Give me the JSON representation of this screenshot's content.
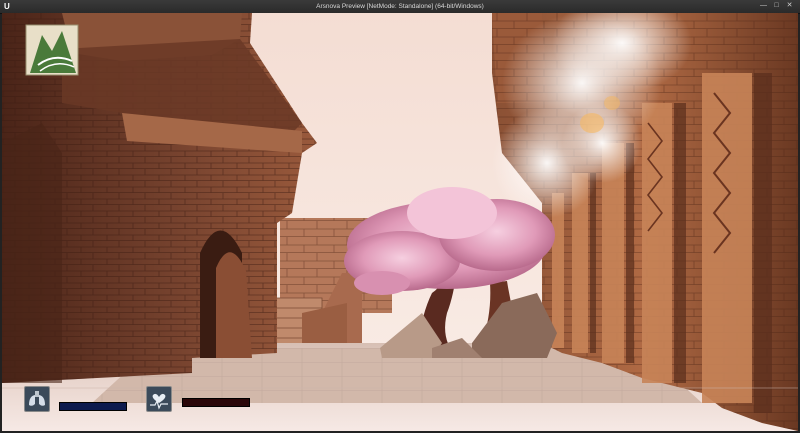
{
  "window": {
    "title": "Arsnova Preview [NetMode: Standalone]  (64-bit/Windows)"
  },
  "hud": {
    "lungs": {
      "icon": "lungs-icon",
      "level": 1.0,
      "color": "#0c1a4e"
    },
    "health": {
      "icon": "heart-monitor-icon",
      "level": 1.0,
      "color": "#2a0608"
    }
  },
  "colors": {
    "sky": "#f7e5dc",
    "stone": "#7a4530",
    "blossom": "#e8a8c4",
    "ground": "#f0e0dc"
  }
}
